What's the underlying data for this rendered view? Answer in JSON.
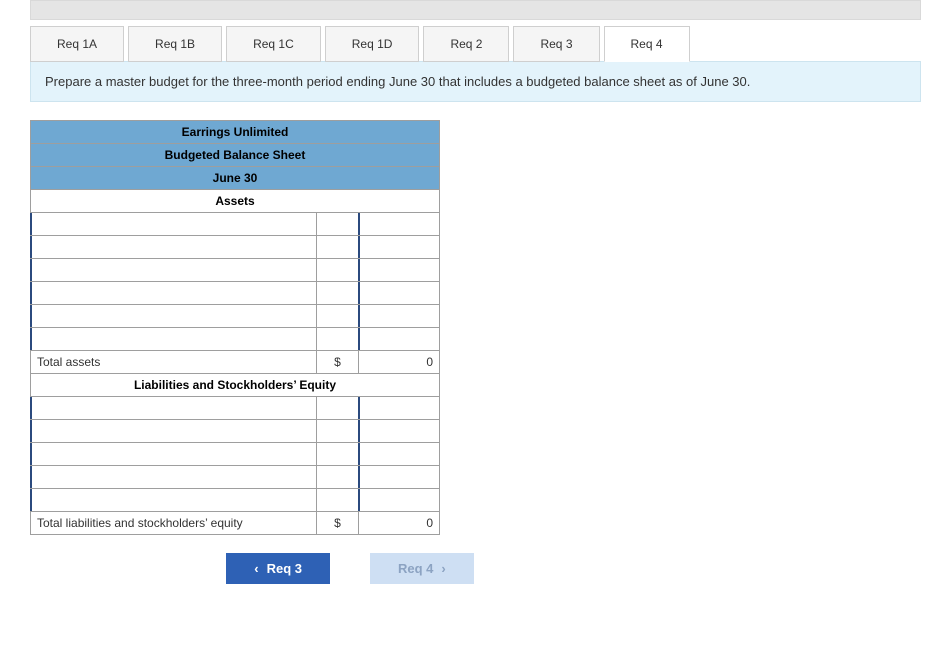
{
  "tabs": {
    "r1a": "Req 1A",
    "r1b": "Req 1B",
    "r1c": "Req 1C",
    "r1d": "Req 1D",
    "r2": "Req 2",
    "r3": "Req 3",
    "r4": "Req 4"
  },
  "instruction": "Prepare a master budget for the three-month period ending June 30 that includes a budgeted balance sheet as of June 30.",
  "sheet": {
    "company": "Earrings Unlimited",
    "report": "Budgeted Balance Sheet",
    "date": "June 30",
    "assets_header": "Assets",
    "total_assets_label": "Total assets",
    "total_assets_sym": "$",
    "total_assets_val": "0",
    "liab_header": "Liabilities and Stockholders’ Equity",
    "total_liab_label": "Total liabilities and stockholders’ equity",
    "total_liab_sym": "$",
    "total_liab_val": "0"
  },
  "pager": {
    "prev": "Req 3",
    "next": "Req 4"
  }
}
